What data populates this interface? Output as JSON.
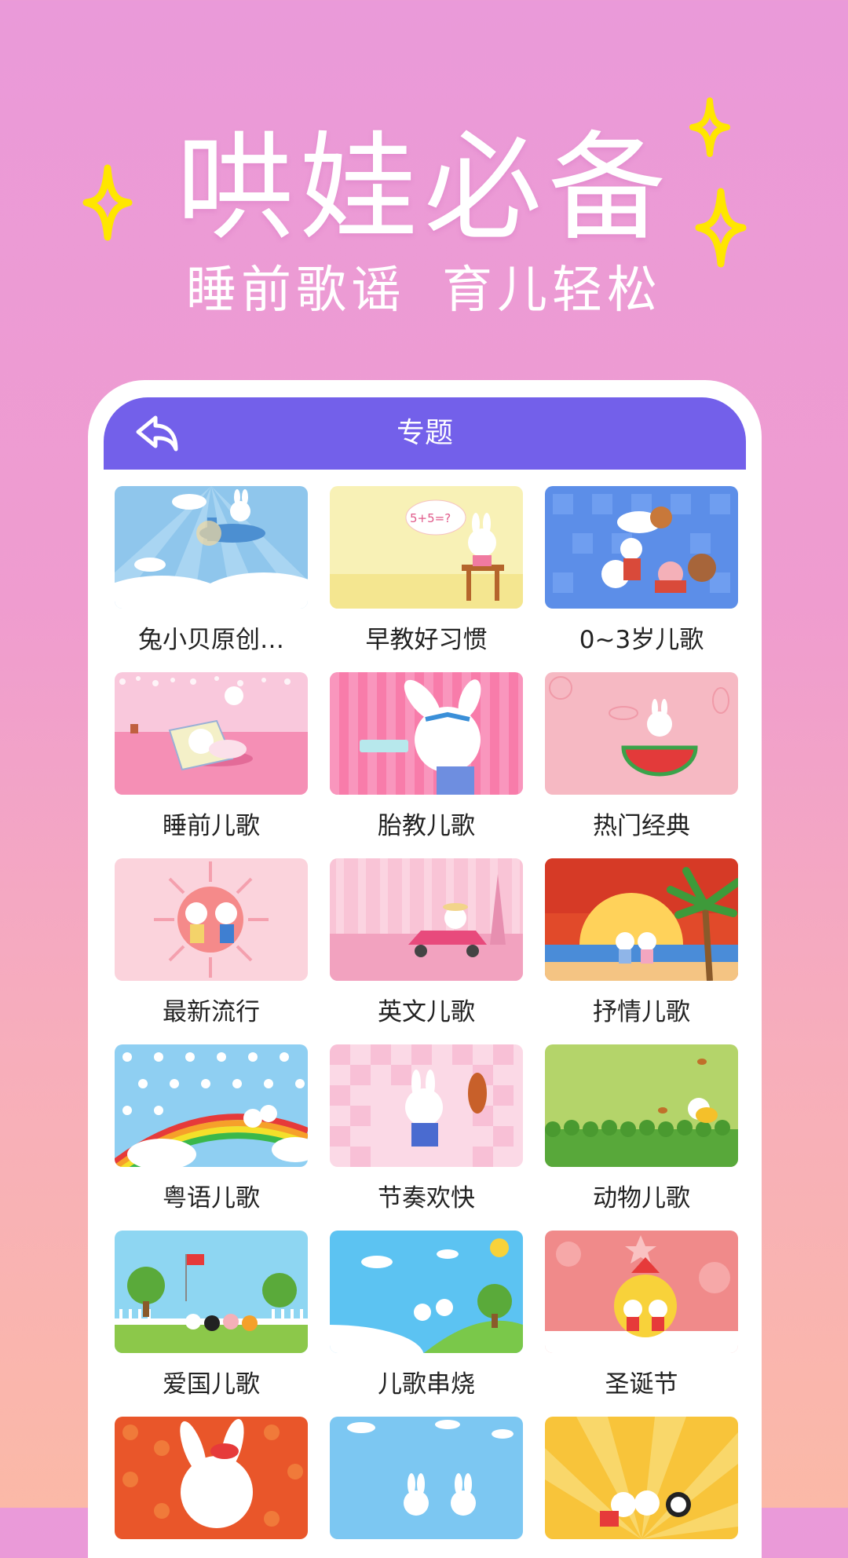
{
  "promo": {
    "headline": "哄娃必备",
    "subline_left": "睡前歌谣",
    "subline_right": "育儿轻松",
    "accent_color": "#ffe600"
  },
  "header": {
    "title": "专题",
    "back_icon": "back-arrow-icon",
    "bar_color": "#7360ea"
  },
  "topics": [
    {
      "label": "兔小贝原创…",
      "theme": "sky-plane"
    },
    {
      "label": "早教好习惯",
      "theme": "yellow-desk"
    },
    {
      "label": "0~3岁儿歌",
      "theme": "blue-pattern"
    },
    {
      "label": "睡前儿歌",
      "theme": "pink-pillow"
    },
    {
      "label": "胎教儿歌",
      "theme": "pink-stripes"
    },
    {
      "label": "热门经典",
      "theme": "pink-watermelon"
    },
    {
      "label": "最新流行",
      "theme": "pink-sun"
    },
    {
      "label": "英文儿歌",
      "theme": "pink-car"
    },
    {
      "label": "抒情儿歌",
      "theme": "sunset-beach"
    },
    {
      "label": "粤语儿歌",
      "theme": "rainbow-dots"
    },
    {
      "label": "节奏欢快",
      "theme": "pink-check"
    },
    {
      "label": "动物儿歌",
      "theme": "green-meadow"
    },
    {
      "label": "爱国儿歌",
      "theme": "park-flags"
    },
    {
      "label": "儿歌串烧",
      "theme": "blue-hills"
    },
    {
      "label": "圣诞节",
      "theme": "christmas"
    },
    {
      "label": "",
      "theme": "red-newyear"
    },
    {
      "label": "",
      "theme": "blue-clouds"
    },
    {
      "label": "",
      "theme": "gold-rays"
    }
  ]
}
